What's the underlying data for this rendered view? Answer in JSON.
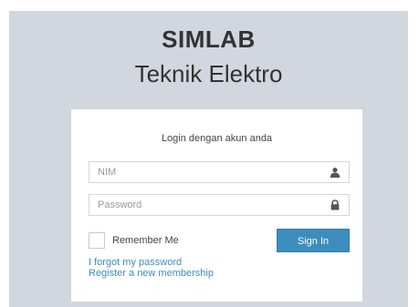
{
  "brand": {
    "title": "SIMLAB",
    "subtitle": "Teknik Elektro"
  },
  "login": {
    "message": "Login dengan akun anda",
    "nim": {
      "placeholder": "NIM",
      "value": "",
      "icon": "user-icon"
    },
    "password": {
      "placeholder": "Password",
      "value": "",
      "icon": "lock-icon"
    },
    "remember_label": "Remember Me",
    "remember_checked": false,
    "signin_label": "Sign In",
    "forgot_link": "I forgot my password",
    "register_link": "Register a new membership"
  },
  "colors": {
    "page_background": "#d2d6de",
    "box_background": "#ffffff",
    "primary_button": "#3c8dbc",
    "link": "#3c8dbc"
  }
}
